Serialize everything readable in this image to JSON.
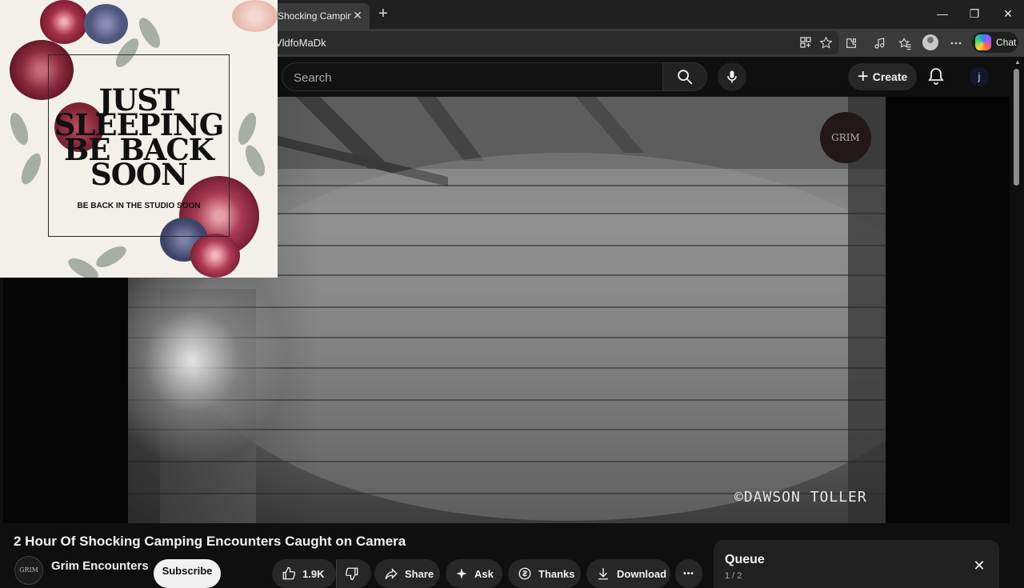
{
  "browser": {
    "tab_title": "Shocking Camping",
    "tab_close": "✕",
    "new_tab": "+",
    "url_fragment": "VldfoMaDk",
    "chat_label": "Chat",
    "window_controls": {
      "minimize": "—",
      "restore": "❐",
      "close": "✕"
    }
  },
  "youtube": {
    "search_placeholder": "Search",
    "create_label": "Create",
    "avatar_letter": "j"
  },
  "video": {
    "watermark": "©DAWSON TOLLER",
    "channel_badge": "GRIM"
  },
  "overlay": {
    "title": "JUST SLEEPING BE BACK SOON",
    "subtitle": "BE BACK IN THE STUDIO SOON"
  },
  "info": {
    "title": "2 Hour Of Shocking Camping Encounters Caught on Camera",
    "channel_name": "Grim Encounters",
    "channel_avatar_text": "GRIM",
    "subscribe_label": "Subscribe",
    "like_count": "1.9K",
    "share_label": "Share",
    "ask_label": "Ask",
    "thanks_label": "Thanks",
    "download_label": "Download",
    "more_label": "•••"
  },
  "queue": {
    "title": "Queue",
    "count": "1 / 2",
    "close": "✕"
  },
  "colors": {
    "page_bg": "#0f0f0f",
    "chrome_bg": "#202020",
    "toolbar_bg": "#3a3a3a",
    "pill_bg": "#272727",
    "accent_flower": "#8b2a3c"
  },
  "icons": [
    "search-icon",
    "mic-icon",
    "bell-icon",
    "plus-icon",
    "like-icon",
    "dislike-icon",
    "share-icon",
    "sparkle-icon",
    "thanks-icon",
    "download-icon",
    "more-icon",
    "close-icon",
    "star-icon",
    "extensions-icon",
    "favorites-icon",
    "copilot-icon"
  ]
}
